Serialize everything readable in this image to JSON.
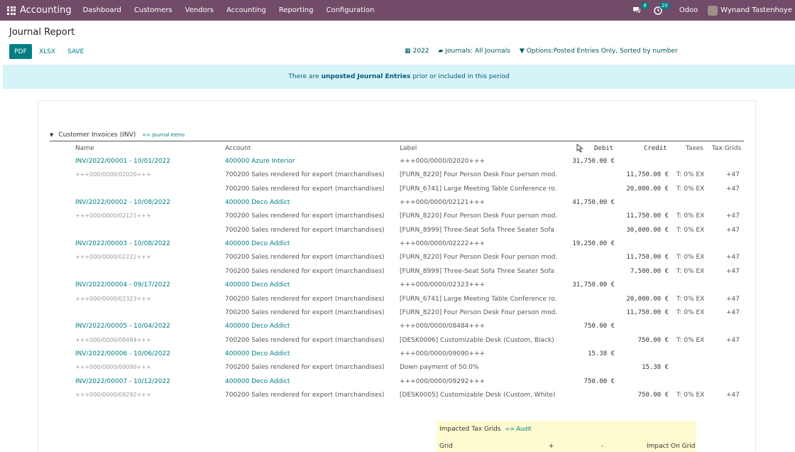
{
  "navbar": {
    "app_name": "Accounting",
    "menu": [
      "Dashboard",
      "Customers",
      "Vendors",
      "Accounting",
      "Reporting",
      "Configuration"
    ],
    "messages_count": "8",
    "activities_count": "20",
    "company": "Odoo",
    "user": "Wynand Tastenhoye"
  },
  "page": {
    "title": "Journal Report",
    "buttons": {
      "pdf": "PDF",
      "xlsx": "XLSX",
      "save": "SAVE"
    },
    "filters": {
      "date": "2022",
      "journals": "Journals: All Journals",
      "options": "Options:Posted Entries Only, Sorted by number"
    }
  },
  "alert": {
    "prefix": "There are",
    "bold": "unposted Journal Entries",
    "suffix": "prior or included in this period"
  },
  "report": {
    "section": "Customer Invoices (INV)",
    "journal_items_link": "=> Journal Items",
    "columns": {
      "name": "Name",
      "account": "Account",
      "label": "Label",
      "debit": "Debit",
      "credit": "Credit",
      "taxes": "Taxes",
      "tax_grids": "Tax Grids"
    },
    "rows": [
      {
        "kind": "move",
        "name": "INV/2022/00001 - 10/01/2022",
        "acct_code": "400000",
        "acct_name": "Azure Interior",
        "label": "+++000/0000/02020+++",
        "debit": "31,750.00 €",
        "credit": "",
        "taxes": "",
        "grids": ""
      },
      {
        "kind": "ref",
        "name": "+++000/0000/02020+++",
        "account": "700200 Sales rendered for export (marchandises)",
        "label": "[FURN_8220] Four Person Desk Four person mod…",
        "debit": "",
        "credit": "11,750.00 €",
        "taxes": "T: 0% EX",
        "grids": "+47"
      },
      {
        "kind": "line",
        "name": "",
        "account": "700200 Sales rendered for export (marchandises)",
        "label": "[FURN_6741] Large Meeting Table Conference ro…",
        "debit": "",
        "credit": "20,000.00 €",
        "taxes": "T: 0% EX",
        "grids": "+47"
      },
      {
        "kind": "move",
        "name": "INV/2022/00002 - 10/08/2022",
        "acct_code": "400000",
        "acct_name": "Deco Addict",
        "label": "+++000/0000/02121+++",
        "debit": "41,750.00 €",
        "credit": "",
        "taxes": "",
        "grids": ""
      },
      {
        "kind": "ref",
        "name": "+++000/0000/02121+++",
        "account": "700200 Sales rendered for export (marchandises)",
        "label": "[FURN_8220] Four Person Desk Four person mod…",
        "debit": "",
        "credit": "11,750.00 €",
        "taxes": "T: 0% EX",
        "grids": "+47"
      },
      {
        "kind": "line",
        "name": "",
        "account": "700200 Sales rendered for export (marchandises)",
        "label": "[FURN_8999] Three-Seat Sofa Three Seater Sofa …",
        "debit": "",
        "credit": "30,000.00 €",
        "taxes": "T: 0% EX",
        "grids": "+47"
      },
      {
        "kind": "move",
        "name": "INV/2022/00003 - 10/08/2022",
        "acct_code": "400000",
        "acct_name": "Deco Addict",
        "label": "+++000/0000/02222+++",
        "debit": "19,250.00 €",
        "credit": "",
        "taxes": "",
        "grids": ""
      },
      {
        "kind": "ref",
        "name": "+++000/0000/02222+++",
        "account": "700200 Sales rendered for export (marchandises)",
        "label": "[FURN_8220] Four Person Desk Four person mod…",
        "debit": "",
        "credit": "11,750.00 €",
        "taxes": "T: 0% EX",
        "grids": "+47"
      },
      {
        "kind": "line",
        "name": "",
        "account": "700200 Sales rendered for export (marchandises)",
        "label": "[FURN_8999] Three-Seat Sofa Three Seater Sofa …",
        "debit": "",
        "credit": "7,500.00 €",
        "taxes": "T: 0% EX",
        "grids": "+47"
      },
      {
        "kind": "move",
        "name": "INV/2022/00004 - 09/17/2022",
        "acct_code": "400000",
        "acct_name": "Deco Addict",
        "label": "+++000/0000/02323+++",
        "debit": "31,750.00 €",
        "credit": "",
        "taxes": "",
        "grids": ""
      },
      {
        "kind": "ref",
        "name": "+++000/0000/02323+++",
        "account": "700200 Sales rendered for export (marchandises)",
        "label": "[FURN_6741] Large Meeting Table Conference ro…",
        "debit": "",
        "credit": "20,000.00 €",
        "taxes": "T: 0% EX",
        "grids": "+47"
      },
      {
        "kind": "line",
        "name": "",
        "account": "700200 Sales rendered for export (marchandises)",
        "label": "[FURN_8220] Four Person Desk Four person mod…",
        "debit": "",
        "credit": "11,750.00 €",
        "taxes": "T: 0% EX",
        "grids": "+47"
      },
      {
        "kind": "move",
        "name": "INV/2022/00005 - 10/04/2022",
        "acct_code": "400000",
        "acct_name": "Deco Addict",
        "label": "+++000/0000/08484+++",
        "debit": "750.00 €",
        "credit": "",
        "taxes": "",
        "grids": ""
      },
      {
        "kind": "ref",
        "name": "+++000/0000/08484+++",
        "account": "700200 Sales rendered for export (marchandises)",
        "label": "[DESK0006] Customizable Desk (Custom, Black) 1…",
        "debit": "",
        "credit": "750.00 €",
        "taxes": "T: 0% EX",
        "grids": "+47"
      },
      {
        "kind": "move",
        "name": "INV/2022/00006 - 10/06/2022",
        "acct_code": "400000",
        "acct_name": "Deco Addict",
        "label": "+++000/0000/09090+++",
        "debit": "15.38 €",
        "credit": "",
        "taxes": "",
        "grids": ""
      },
      {
        "kind": "ref",
        "name": "+++000/0000/09090+++",
        "account": "700200 Sales rendered for export (marchandises)",
        "label": "Down payment of 50.0%",
        "debit": "",
        "credit": "15.38 €",
        "taxes": "",
        "grids": ""
      },
      {
        "kind": "move",
        "name": "INV/2022/00007 - 10/12/2022",
        "acct_code": "400000",
        "acct_name": "Deco Addict",
        "label": "+++000/0000/09292+++",
        "debit": "750.00 €",
        "credit": "",
        "taxes": "",
        "grids": ""
      },
      {
        "kind": "ref",
        "name": "+++000/0000/09292+++",
        "account": "700200 Sales rendered for export (marchandises)",
        "label": "[DESK0005] Customizable Desk (Custom, White) …",
        "debit": "",
        "credit": "750.00 €",
        "taxes": "T: 0% EX",
        "grids": "+47"
      }
    ]
  },
  "tax_grids": {
    "title": "Impacted Tax Grids",
    "audit_link": "=> Audit",
    "col_grid": "Grid",
    "col_plus": "+",
    "col_minus": "-",
    "col_impact": "Impact On Grid"
  }
}
